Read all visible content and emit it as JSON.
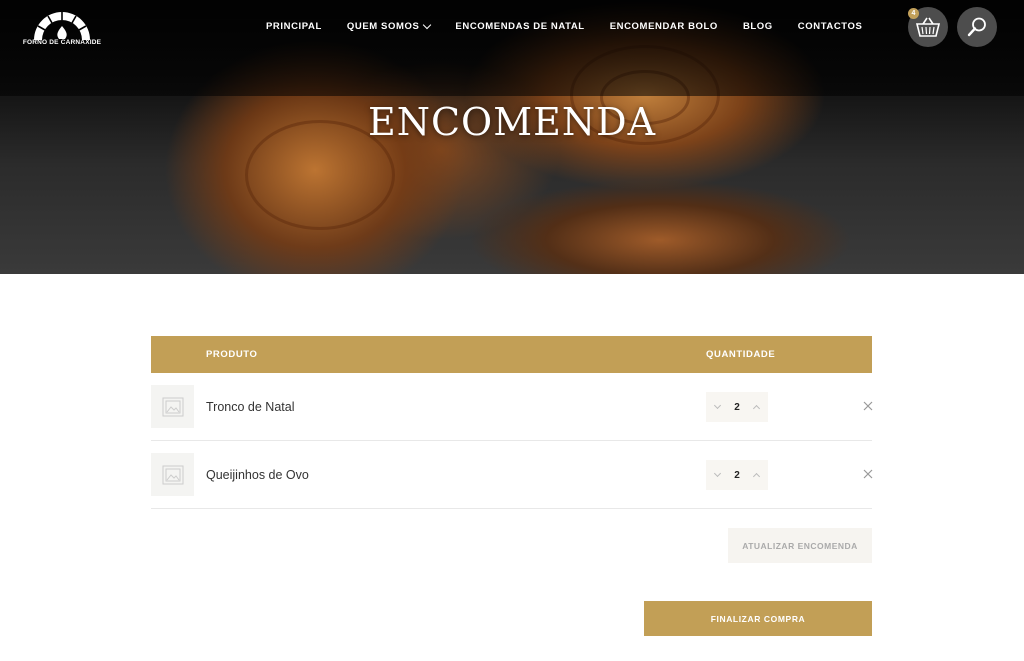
{
  "brand": {
    "name": "FORNO DE CARNAXIDE"
  },
  "nav": {
    "items": [
      {
        "label": "PRINCIPAL"
      },
      {
        "label": "QUEM SOMOS",
        "has_dropdown": true
      },
      {
        "label": "ENCOMENDAS DE NATAL"
      },
      {
        "label": "ENCOMENDAR BOLO"
      },
      {
        "label": "BLOG"
      },
      {
        "label": "CONTACTOS"
      }
    ]
  },
  "header": {
    "cart_count": "4",
    "cart_icon": "basket-icon",
    "search_icon": "search-icon"
  },
  "hero": {
    "title": "ENCOMENDA"
  },
  "cart_table": {
    "col_product": "PRODUTO",
    "col_quantity": "QUANTIDADE",
    "rows": [
      {
        "product": "Tronco de Natal",
        "quantity": "2"
      },
      {
        "product": "Queijinhos de Ovo",
        "quantity": "2"
      }
    ]
  },
  "actions": {
    "update_label": "ATUALIZAR ENCOMENDA",
    "checkout_label": "FINALIZAR COMPRA"
  },
  "colors": {
    "accent": "#c29f56",
    "hero_dark": "#111111"
  }
}
